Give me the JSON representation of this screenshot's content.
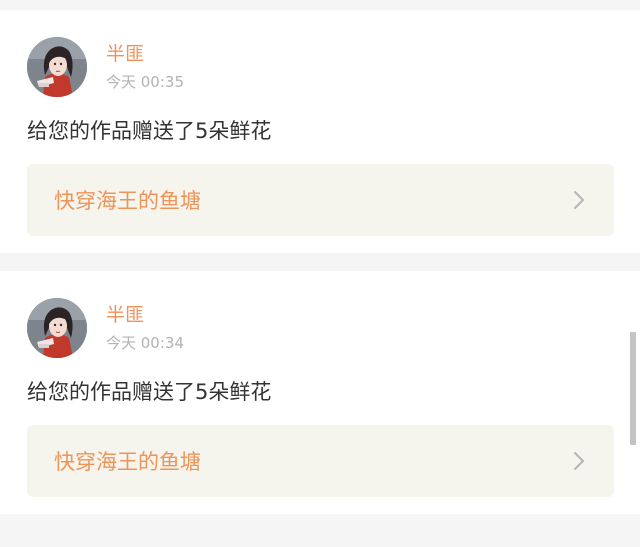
{
  "notifications": [
    {
      "user_name": "半匪",
      "timestamp": "今天 00:35",
      "message": "给您的作品赠送了5朵鲜花",
      "work_title": "快穿海王的鱼塘",
      "avatar_icon": "user-avatar-anime-portrait",
      "chevron_icon": "chevron-right-icon"
    },
    {
      "user_name": "半匪",
      "timestamp": "今天 00:34",
      "message": "给您的作品赠送了5朵鲜花",
      "work_title": "快穿海王的鱼塘",
      "avatar_icon": "user-avatar-anime-portrait",
      "chevron_icon": "chevron-right-icon"
    }
  ],
  "colors": {
    "accent": "#f0935a",
    "page_background": "#f5f5f5",
    "card_background": "#ffffff",
    "link_background": "#f5f5ee",
    "text_primary": "#333333",
    "text_muted": "#b3b3b3"
  }
}
